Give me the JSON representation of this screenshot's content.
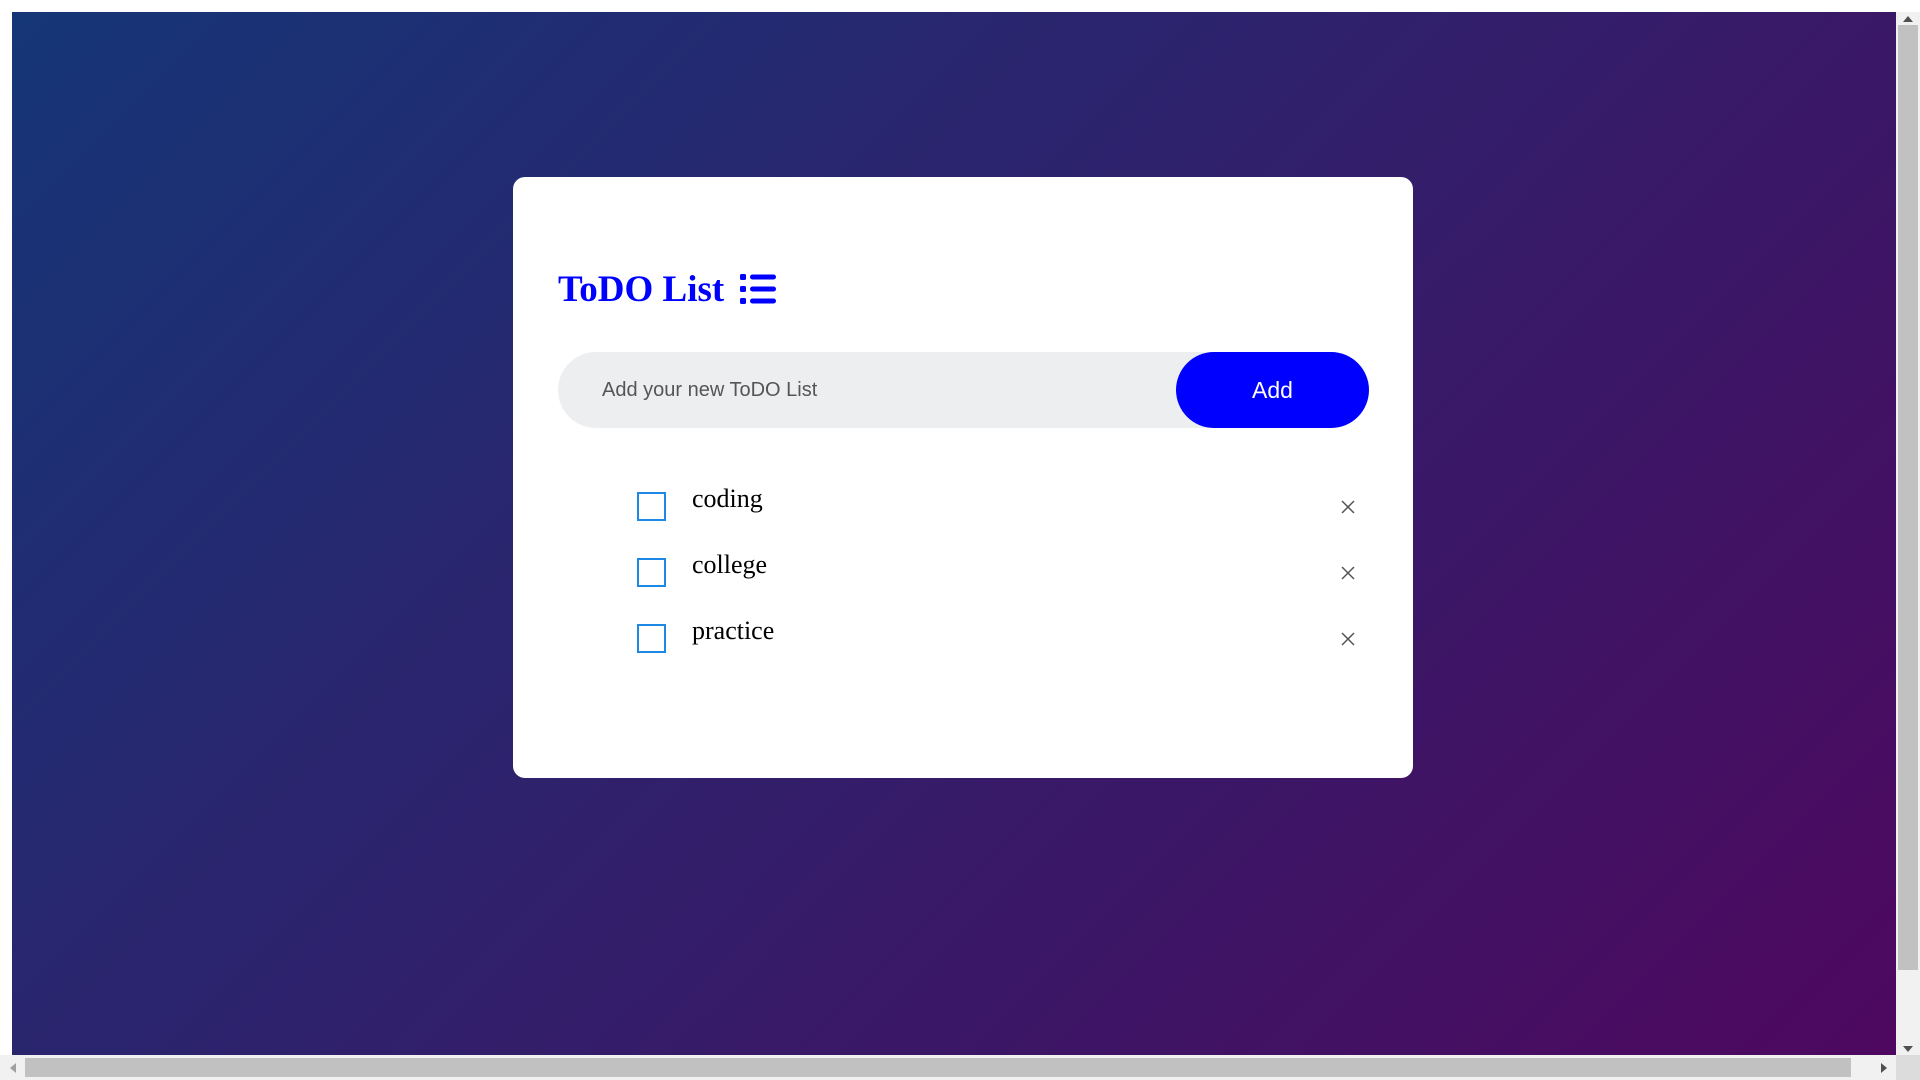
{
  "app": {
    "title": "ToDO List",
    "title_icon": "list-icon"
  },
  "input": {
    "value": "",
    "placeholder": "Add your new ToDO List"
  },
  "add_button": {
    "label": "Add"
  },
  "todos": [
    {
      "label": "coding",
      "checked": false,
      "remove_icon": "close-icon"
    },
    {
      "label": "college",
      "checked": false,
      "remove_icon": "close-icon"
    },
    {
      "label": "practice",
      "checked": false,
      "remove_icon": "close-icon"
    }
  ],
  "colors": {
    "background_gradient_start": "#153677",
    "background_gradient_end": "#4e085f",
    "accent": "#0000ff",
    "checkbox_border": "#1e88e5",
    "input_background": "#edeef0",
    "card": "#ffffff"
  }
}
